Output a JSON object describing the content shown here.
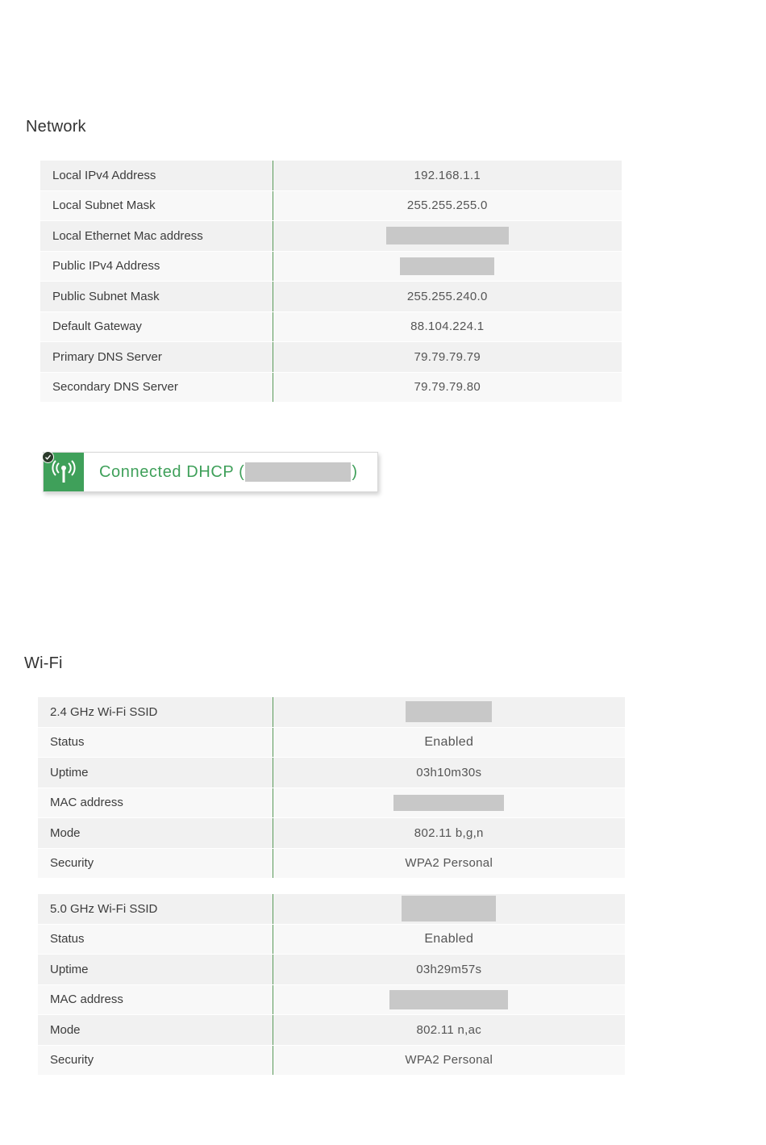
{
  "network": {
    "title": "Network",
    "rows": [
      {
        "label": "Local IPv4 Address",
        "value": "192.168.1.1"
      },
      {
        "label": "Local Subnet Mask",
        "value": "255.255.255.0"
      },
      {
        "label": "Local Ethernet Mac address",
        "value": ""
      },
      {
        "label": "Public IPv4 Address",
        "value": ""
      },
      {
        "label": "Public Subnet Mask",
        "value": "255.255.240.0"
      },
      {
        "label": "Default Gateway",
        "value": "88.104.224.1"
      },
      {
        "label": "Primary DNS Server",
        "value": "79.79.79.79"
      },
      {
        "label": "Secondary DNS Server",
        "value": "79.79.79.80"
      }
    ],
    "connection": {
      "status_prefix": "Connected DHCP (",
      "status_suffix": ")",
      "icon": "wifi-antenna-icon",
      "badge_icon": "check-icon"
    }
  },
  "wifi": {
    "title": "Wi-Fi",
    "band_24": {
      "rows": [
        {
          "label": "2.4 GHz Wi-Fi SSID",
          "value": ""
        },
        {
          "label": "Status",
          "value": "Enabled"
        },
        {
          "label": "Uptime",
          "value": "03h10m30s"
        },
        {
          "label": "MAC address",
          "value": ""
        },
        {
          "label": "Mode",
          "value": "802.11 b,g,n"
        },
        {
          "label": "Security",
          "value": "WPA2 Personal"
        }
      ]
    },
    "band_50": {
      "rows": [
        {
          "label": "5.0 GHz Wi-Fi SSID",
          "value": ""
        },
        {
          "label": "Status",
          "value": "Enabled"
        },
        {
          "label": "Uptime",
          "value": "03h29m57s"
        },
        {
          "label": "MAC address",
          "value": ""
        },
        {
          "label": "Mode",
          "value": "802.11 n,ac"
        },
        {
          "label": "Security",
          "value": "WPA2 Personal"
        }
      ]
    }
  },
  "colors": {
    "accent_green": "#3fa05a",
    "enabled_green": "#2f8f2f",
    "redaction_gray": "#c8c8c8"
  }
}
